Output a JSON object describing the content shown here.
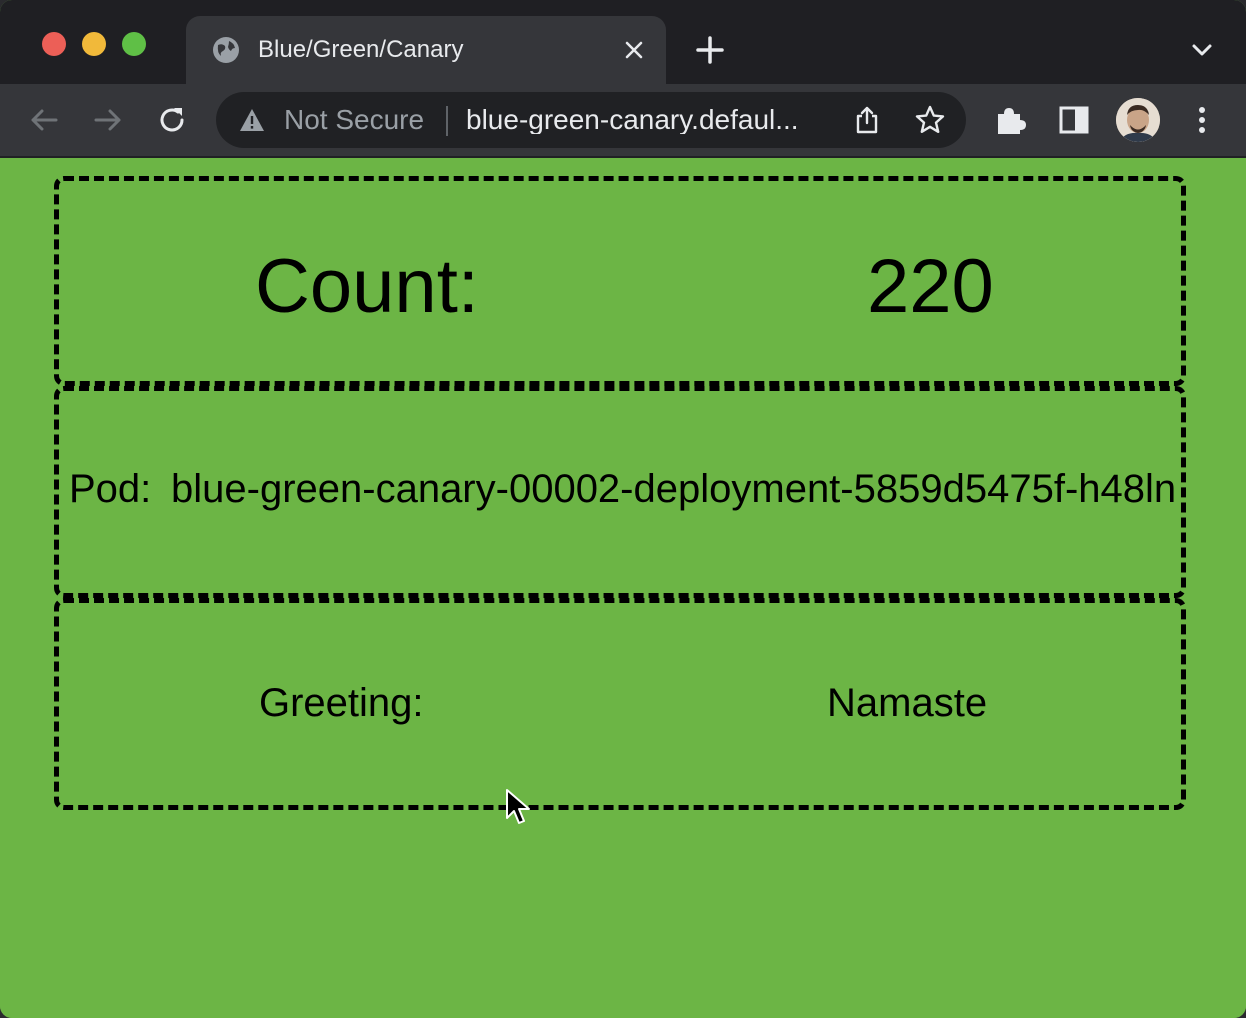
{
  "browser": {
    "tab": {
      "title": "Blue/Green/Canary"
    },
    "omnibox": {
      "security_label": "Not Secure",
      "url": "blue-green-canary.defaul..."
    }
  },
  "page": {
    "count": {
      "label": "Count:",
      "value": "220"
    },
    "pod": {
      "label": "Pod:",
      "value": "blue-green-canary-00002-deployment-5859d5475f-h48ln"
    },
    "greeting": {
      "label": "Greeting:",
      "value": "Namaste"
    },
    "background_color": "#6cb545"
  }
}
